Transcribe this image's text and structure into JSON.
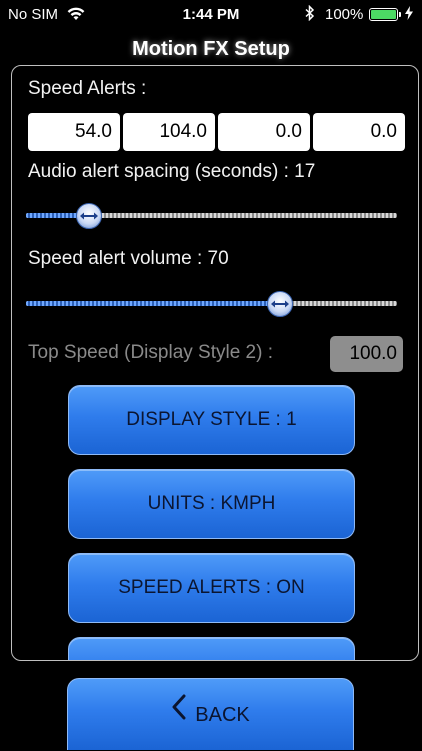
{
  "status_bar": {
    "carrier": "No SIM",
    "time": "1:44 PM",
    "battery_percent": "100%",
    "battery_level": 1.0
  },
  "header": {
    "title": "Motion FX Setup"
  },
  "speed_alerts": {
    "label": "Speed Alerts :",
    "values": [
      "54.0",
      "104.0",
      "0.0",
      "0.0"
    ]
  },
  "audio_spacing": {
    "label": "Audio alert spacing (seconds) : 17",
    "slider_fraction": 0.17
  },
  "volume": {
    "label": "Speed alert volume : 70",
    "slider_fraction": 0.685
  },
  "top_speed": {
    "label": "Top Speed (Display Style 2) :",
    "value": "100.0"
  },
  "buttons": {
    "display_style": "DISPLAY STYLE : 1",
    "units": "UNITS : KMPH",
    "speed_alerts": "SPEED ALERTS : ON",
    "back": "BACK"
  },
  "colors": {
    "accent_blue": "#2f7cec",
    "battery_green": "#4cd964"
  }
}
